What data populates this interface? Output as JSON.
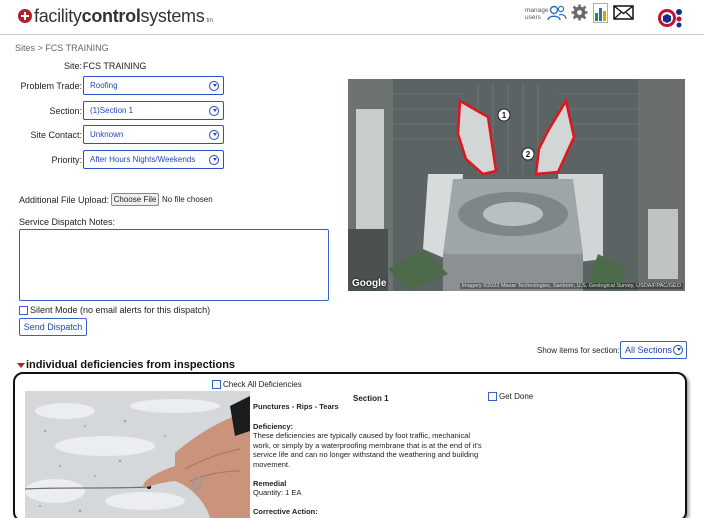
{
  "header": {
    "logo_prefix": "facility",
    "logo_bold": "control",
    "logo_suffix": "systems",
    "logo_tm": "tm",
    "manage_users_line1": "manage",
    "manage_users_line2": "users",
    "icons": [
      "logo-cross-icon",
      "users-icon",
      "gear-icon",
      "bar-chart-icon",
      "mail-icon",
      "cube-icon"
    ]
  },
  "breadcrumb": "Sites > FCS TRAINING",
  "form": {
    "site_label": "Site:",
    "site_value": "FCS TRAINING",
    "problem_trade_label": "Problem Trade:",
    "problem_trade_value": "Roofing",
    "section_label": "Section:",
    "section_value": "(1)Section 1",
    "site_contact_label": "Site Contact:",
    "site_contact_value": "Unknown",
    "priority_label": "Priority:",
    "priority_value": "After Hours Nights/Weekends",
    "upload_label": "Additional File Upload:",
    "choose_file_label": "Choose File",
    "file_status": "No file chosen",
    "notes_label": "Service Dispatch Notes:",
    "notes_value": "",
    "silent_mode_label": "Silent Mode (no email alerts for this dispatch)",
    "send_button": "Send Dispatch"
  },
  "map": {
    "marker_1": "1",
    "marker_2": "2",
    "google_label": "Google",
    "attribution": "Imagery ©2022 Maxar Technologies, Sanborn, U.S. Geological Survey, USDA/FPAC/GEO",
    "highlight_color": "#e0161c"
  },
  "show_items": {
    "label": "Show items for section:",
    "selected": "All Sections"
  },
  "deficiencies": {
    "heading": "individual deficiencies from inspections",
    "check_all_label": "Check All Deficiencies",
    "section_title": "Section 1",
    "get_done_label": "Get Done",
    "title": "Punctures - Rips - Tears",
    "deficiency_label": "Deficiency:",
    "deficiency_text": "These deficiencies are typically caused by foot traffic, mechanical work, or simply by a waterproofing membrane that is at the end of it's service life and can no longer withstand the weathering and building movement.",
    "remedial_label": "Remedial",
    "quantity": "Quantity: 1 EA",
    "corrective_label": "Corrective Action:"
  },
  "colors": {
    "accent_blue": "#2347b8",
    "brand_red": "#b3202a"
  }
}
